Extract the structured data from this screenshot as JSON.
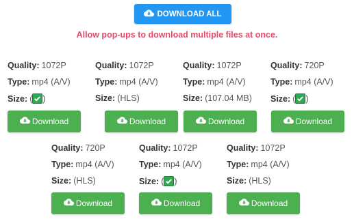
{
  "header": {
    "download_all_label": "DOWNLOAD ALL",
    "notice": "Allow pop-ups to download multiple files at once."
  },
  "labels": {
    "quality": "Quality:",
    "type": "Type:",
    "size": "Size:"
  },
  "colors": {
    "download_all_bg": "#2196f3",
    "download_bg": "#4caf50",
    "notice": "#e34b6a",
    "check": "#33a853"
  },
  "videos": [
    {
      "quality": "1072P",
      "type": "mp4 (A/V)",
      "size_open": "(",
      "size_text": "",
      "size_close": ")",
      "size_check": true,
      "download_label": "Download",
      "icon": "cloud-download-icon"
    },
    {
      "quality": "1072P",
      "type": "mp4 (A/V)",
      "size_open": "",
      "size_text": "(HLS)",
      "size_close": "",
      "size_check": false,
      "download_label": "Download",
      "icon": "cloud-download-icon"
    },
    {
      "quality": "1072P",
      "type": "mp4 (A/V)",
      "size_open": "",
      "size_text": "(107.04 MB)",
      "size_close": "",
      "size_check": false,
      "download_label": "Download",
      "icon": "cloud-download-icon"
    },
    {
      "quality": "720P",
      "type": "mp4 (A/V)",
      "size_open": "(",
      "size_text": "",
      "size_close": ")",
      "size_check": true,
      "download_label": "Download",
      "icon": "cloud-download-icon"
    },
    {
      "quality": "720P",
      "type": "mp4 (A/V)",
      "size_open": "",
      "size_text": "(HLS)",
      "size_close": "",
      "size_check": false,
      "download_label": "Download",
      "icon": "cloud-download-icon"
    },
    {
      "quality": "1072P",
      "type": "mp4 (A/V)",
      "size_open": "(",
      "size_text": "",
      "size_close": ")",
      "size_check": true,
      "download_label": "Download",
      "icon": "cloud-download-icon"
    },
    {
      "quality": "1072P",
      "type": "mp4 (A/V)",
      "size_open": "",
      "size_text": "(HLS)",
      "size_close": "",
      "size_check": false,
      "download_label": "Download",
      "icon": "cloud-download-icon"
    }
  ]
}
